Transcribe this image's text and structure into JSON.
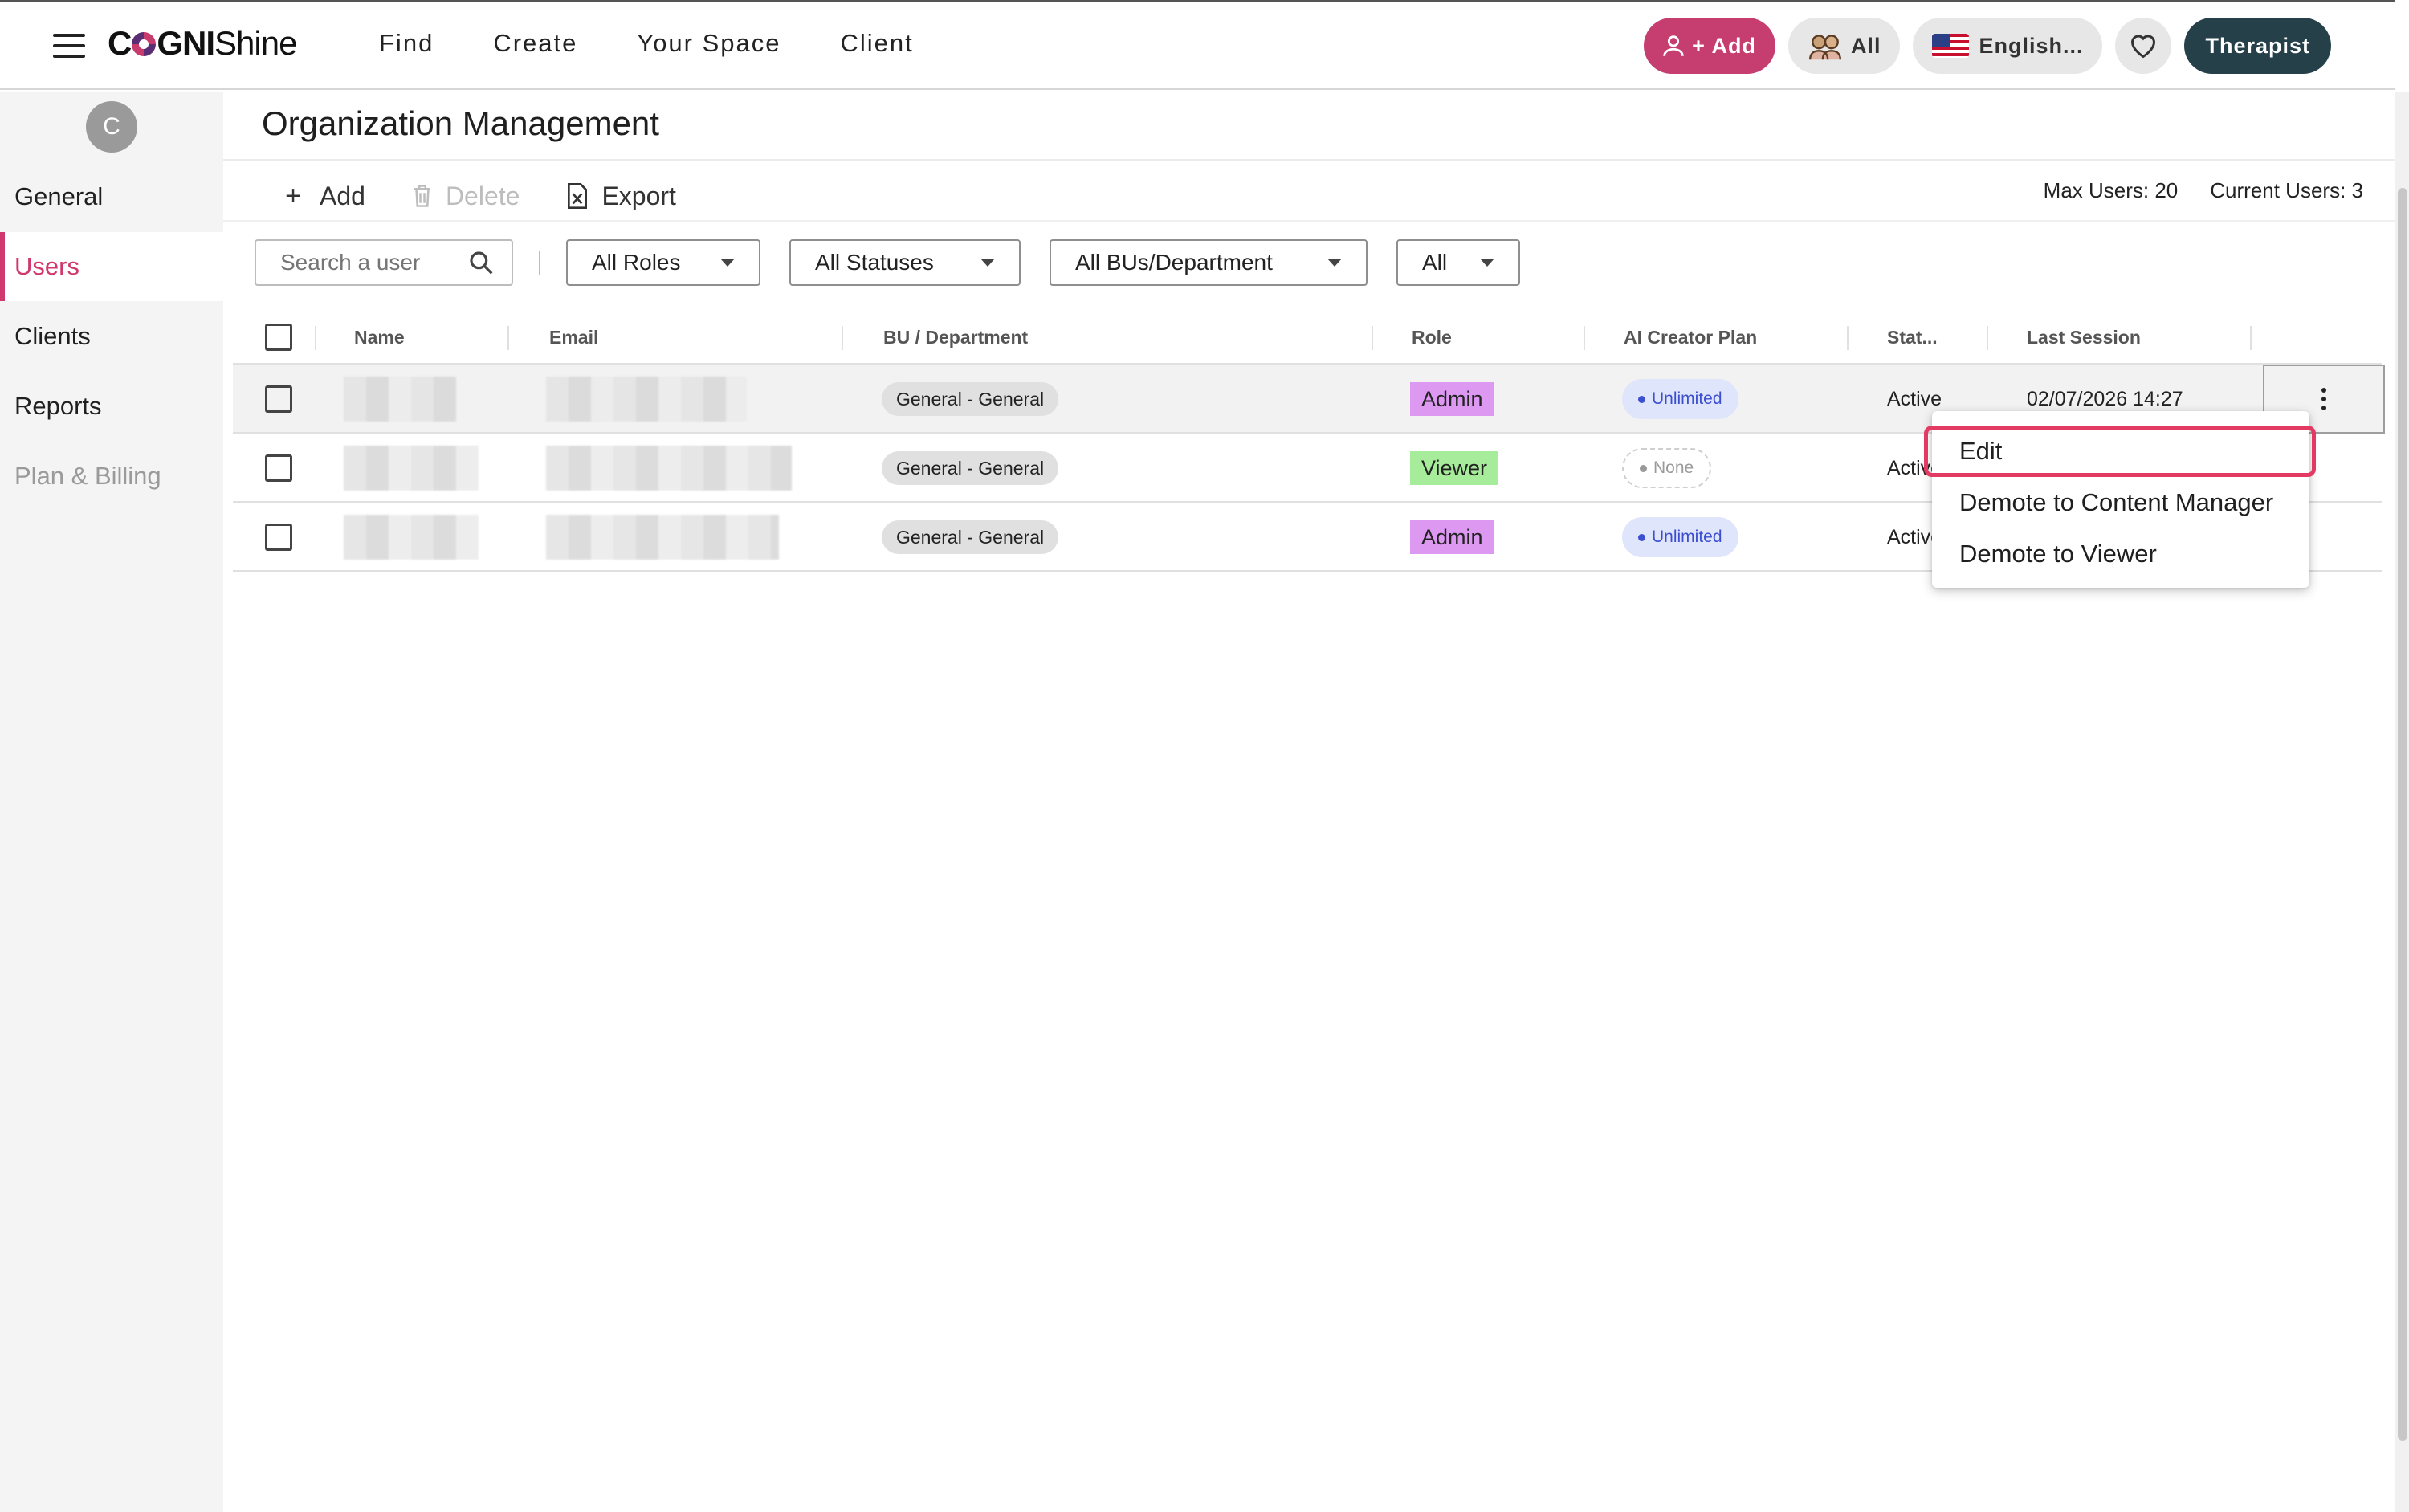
{
  "header": {
    "logo": {
      "prefix": "C",
      "suffix_bold": "GNI",
      "suffix_thin": "Shine"
    },
    "nav": [
      "Find",
      "Create",
      "Your Space",
      "Client"
    ],
    "add_label": "+ Add",
    "all_label": "All",
    "language_label": "English...",
    "role_label": "Therapist"
  },
  "sidebar": {
    "avatar_letter": "C",
    "items": [
      {
        "label": "General",
        "active": false
      },
      {
        "label": "Users",
        "active": true
      },
      {
        "label": "Clients",
        "active": false
      },
      {
        "label": "Reports",
        "active": false
      },
      {
        "label": "Plan & Billing",
        "active": false
      }
    ]
  },
  "page": {
    "title": "Organization Management",
    "toolbar": {
      "add": "Add",
      "delete": "Delete",
      "export": "Export"
    },
    "max_users": "Max Users: 20",
    "current_users": "Current Users: 3"
  },
  "filters": {
    "search_placeholder": "Search a user",
    "roles": "All Roles",
    "statuses": "All Statuses",
    "departments": "All BUs/Department",
    "plan": "All"
  },
  "table": {
    "columns": [
      "Name",
      "Email",
      "BU / Department",
      "Role",
      "AI Creator Plan",
      "Stat...",
      "Last Session"
    ],
    "rows": [
      {
        "department": "General - General",
        "role": "Admin",
        "plan": "Unlimited",
        "status": "Active",
        "last_session": "02/07/2026 14:27"
      },
      {
        "department": "General - General",
        "role": "Viewer",
        "plan": "None",
        "status": "Active",
        "last_session": ""
      },
      {
        "department": "General - General",
        "role": "Admin",
        "plan": "Unlimited",
        "status": "Active",
        "last_session": ""
      }
    ]
  },
  "context_menu": {
    "items": [
      "Edit",
      "Demote to Content Manager",
      "Demote to Viewer"
    ]
  },
  "colors": {
    "brand_pink": "#c63d6f",
    "brand_dark": "#264049",
    "admin_badge": "#dd99f2",
    "viewer_badge": "#a6ec9a",
    "highlight": "#e23a62"
  }
}
